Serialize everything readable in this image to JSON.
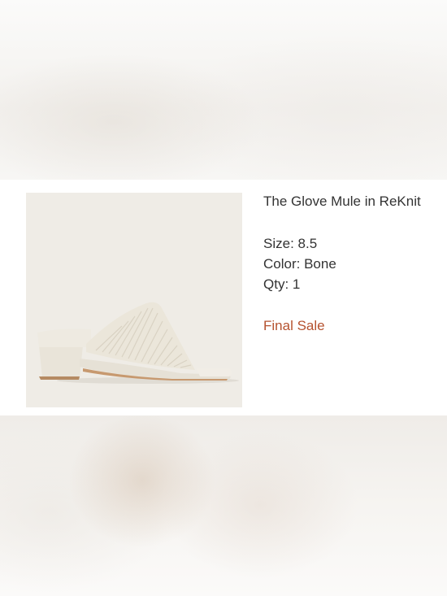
{
  "product": {
    "name": "The Glove Mule in ReKnit",
    "size_text": "Size: 8.5",
    "color_text": "Color: Bone",
    "qty_text": "Qty: 1",
    "sale_label": "Final Sale",
    "image_icon": "mule-shoe-image"
  },
  "colors": {
    "sale_accent": "#b5522f",
    "image_background": "#efece6",
    "shoe_color": "#ece8de"
  }
}
